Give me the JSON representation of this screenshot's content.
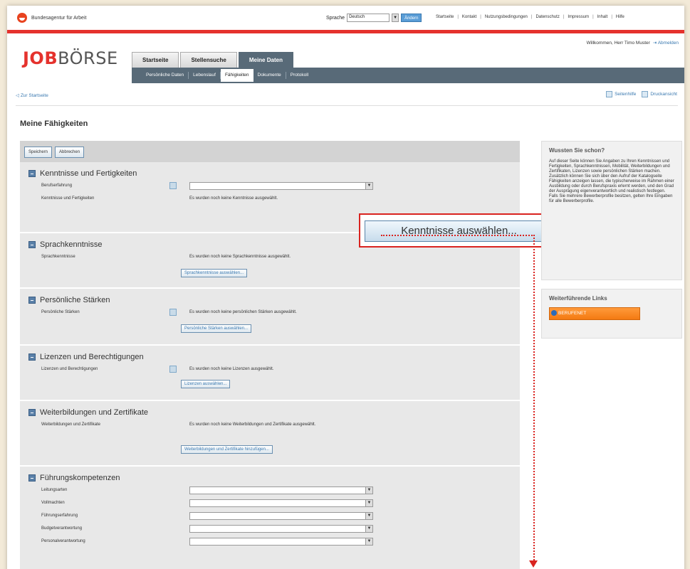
{
  "top": {
    "org_name": "Bundesagentur für Arbeit",
    "language_label": "Sprache",
    "language_value": "Deutsch",
    "language_submit": "Ändern",
    "links": [
      "Startseite",
      "Kontakt",
      "Nutzungsbedingungen",
      "Datenschutz",
      "Impressum",
      "Inhalt",
      "Hilfe"
    ]
  },
  "header": {
    "logo_red": "JOB",
    "logo_rest": "BÖRSE",
    "welcome": "Willkommen, Herr Timo Muster",
    "logout": "Abmelden",
    "tabs": [
      "Startseite",
      "Stellensuche",
      "Meine Daten"
    ],
    "subnav": [
      "Persönliche Daten",
      "Lebenslauf",
      "Fähigkeiten",
      "Dokumente",
      "Protokoll"
    ]
  },
  "crumb": "Zur Startseite",
  "tools": {
    "help": "Seitenhilfe",
    "print": "Druckansicht"
  },
  "page_title": "Meine Fähigkeiten",
  "actions": {
    "save": "Speichern",
    "cancel": "Abbrechen"
  },
  "sections": {
    "skills": {
      "title": "Kenntnisse und Fertigkeiten",
      "experience_label": "Berufserfahrung",
      "skills_label": "Kenntnisse und Fertigkeiten",
      "skills_text": "Es wurden noch keine Kenntnisse ausgewählt.",
      "big_button": "Kenntnisse auswählen..."
    },
    "languages": {
      "title": "Sprachkenntnisse",
      "label": "Sprachkenntnisse",
      "text": "Es wurden noch keine Sprachkenntnisse ausgewählt.",
      "button": "Sprachkenntnisse auswählen..."
    },
    "strengths": {
      "title": "Persönliche Stärken",
      "label": "Persönliche Stärken",
      "text": "Es wurden noch keine persönlichen Stärken ausgewählt.",
      "button": "Persönliche Stärken auswählen..."
    },
    "licenses": {
      "title": "Lizenzen und Berechtigungen",
      "label": "Lizenzen und Berechtigungen",
      "text": "Es wurden noch keine Lizenzen ausgewählt.",
      "button": "Lizenzen auswählen..."
    },
    "training": {
      "title": "Weiterbildungen und Zertifikate",
      "label": "Weiterbildungen und Zertifikate",
      "text": "Es wurden noch keine Weiterbildungen und Zertifikate ausgewählt.",
      "button": "Weiterbildungen und Zertifikate hinzufügen..."
    },
    "leadership": {
      "title": "Führungskompetenzen",
      "fields": [
        "Leitungsarten",
        "Vollmachten",
        "Führungserfahrung",
        "Budgetverantwortung",
        "Personalverantwortung"
      ]
    }
  },
  "sidebar": {
    "info_title": "Wussten Sie schon?",
    "info_text": "Auf dieser Seite können Sie Angaben zu Ihren Kenntnissen und Fertigkeiten, Sprachkenntnissen, Mobilität, Weiterbildungen und Zertifikaten, Lizenzen sowie persönlichen Stärken machen. Zusätzlich können Sie sich über den Aufruf der Katalogseite Fähigkeiten anzeigen lassen, die typischerweise im Rahmen einer Ausbildung oder durch Berufspraxis erlernt werden, und den Grad der Ausprägung eigenverantwortlich und realistisch festlegen. Falls Sie mehrere Bewerberprofile besitzen, gelten Ihre Eingaben für alle Bewerberprofile.",
    "links_title": "Weiterführende Links",
    "links_button": "BERUFENET"
  }
}
